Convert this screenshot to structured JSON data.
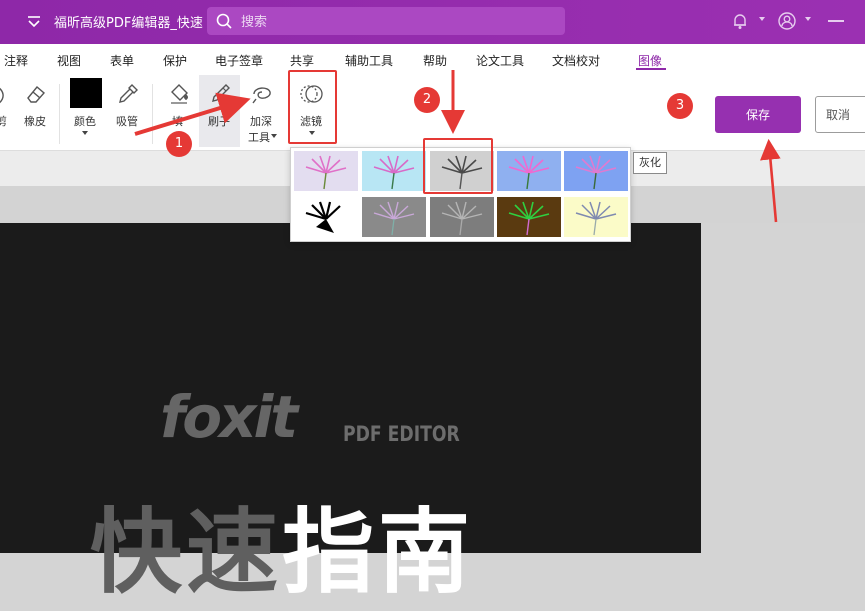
{
  "titlebar": {
    "doc_title": "福昕高级PDF编辑器_快速...",
    "search_placeholder": "搜索"
  },
  "menu_tabs": [
    {
      "label": "注释"
    },
    {
      "label": "视图"
    },
    {
      "label": "表单"
    },
    {
      "label": "保护"
    },
    {
      "label": "电子签章"
    },
    {
      "label": "共享"
    },
    {
      "label": "辅助工具"
    },
    {
      "label": "帮助"
    },
    {
      "label": "论文工具"
    },
    {
      "label": "文档校对"
    },
    {
      "label": "图像",
      "active": true
    }
  ],
  "ribbon": {
    "clipped_left_label": "剪",
    "eraser_label": "橡皮",
    "color_label": "颜色",
    "eyedropper_label": "吸管",
    "fill_label_top": "填",
    "fill_label_bottom": "充",
    "brush_label": "刷子",
    "burn_label_top": "加深",
    "burn_label_bottom": "工具",
    "filter_label": "滤镜",
    "color_value": "#000000"
  },
  "actions": {
    "save_label": "保存",
    "cancel_label": "取消"
  },
  "filter_menu": {
    "tooltip": "灰化",
    "selected_index": 2
  },
  "annotations": {
    "step1": "1",
    "step2": "2",
    "step3": "3"
  },
  "document": {
    "logo_text": "foxit",
    "product_text": "PDF EDITOR",
    "headline_dim": "快速",
    "headline_bright": "指南"
  },
  "colors": {
    "brand": "#9630b0",
    "annotation_red": "#e53935"
  }
}
